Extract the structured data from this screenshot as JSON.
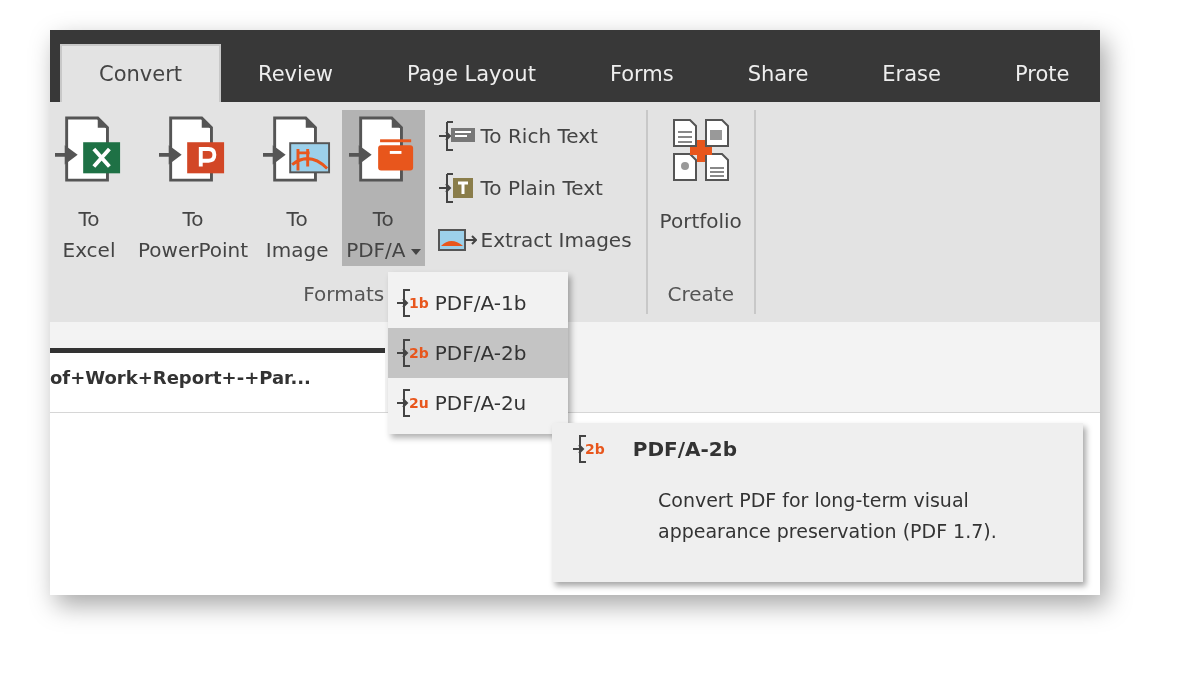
{
  "tabs": [
    {
      "label": "Convert",
      "selected": true
    },
    {
      "label": "Review",
      "selected": false
    },
    {
      "label": "Page Layout",
      "selected": false
    },
    {
      "label": "Forms",
      "selected": false
    },
    {
      "label": "Share",
      "selected": false
    },
    {
      "label": "Erase",
      "selected": false
    },
    {
      "label": "Prote",
      "selected": false
    }
  ],
  "ribbon": {
    "groups": [
      {
        "label": "Formats",
        "large_buttons": [
          {
            "kind": "excel",
            "lines": [
              "To",
              "Excel"
            ],
            "expanded": false
          },
          {
            "kind": "powerpoint",
            "lines": [
              "To",
              "PowerPoint"
            ],
            "expanded": false
          },
          {
            "kind": "image",
            "lines": [
              "To",
              "Image"
            ],
            "expanded": false
          },
          {
            "kind": "pdfa",
            "lines": [
              "To",
              "PDF/A"
            ],
            "expanded": true
          }
        ],
        "small_buttons": [
          {
            "kind": "rich-text",
            "label": "To Rich Text"
          },
          {
            "kind": "plain-text",
            "label": "To Plain Text"
          },
          {
            "kind": "extract-images",
            "label": "Extract Images"
          }
        ]
      },
      {
        "label": "Create",
        "large_buttons": [
          {
            "kind": "portfolio",
            "lines": [
              "Portfolio"
            ],
            "expanded": false
          }
        ]
      }
    ]
  },
  "document_tab": {
    "title": "of+Work+Report+-+Par..."
  },
  "menu": {
    "items": [
      {
        "badge": "1b",
        "label": "PDF/A-1b",
        "selected": false
      },
      {
        "badge": "2b",
        "label": "PDF/A-2b",
        "selected": true
      },
      {
        "badge": "2u",
        "label": "PDF/A-2u",
        "selected": false
      }
    ]
  },
  "tooltip": {
    "badge": "2b",
    "title": "PDF/A-2b",
    "text": "Convert PDF for long-term visual appearance preservation (PDF 1.7)."
  }
}
